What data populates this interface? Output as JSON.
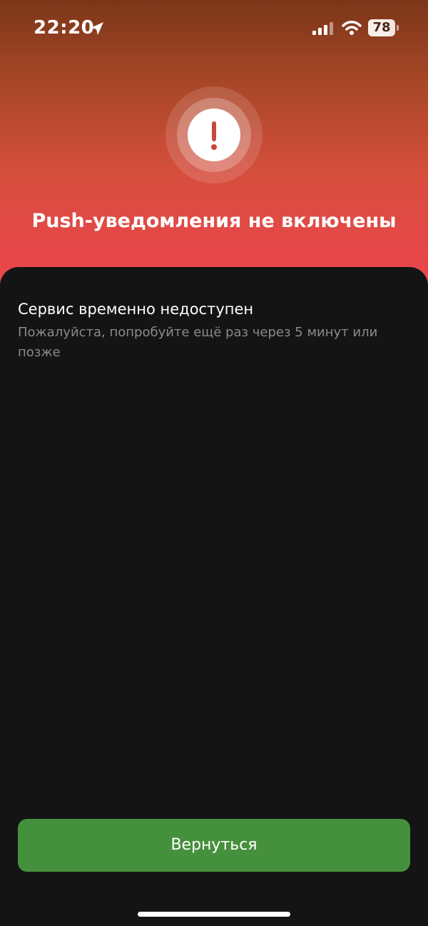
{
  "status_bar": {
    "time": "22:20",
    "battery_level": "78",
    "icons": [
      "location-arrow-icon",
      "cellular-signal-icon",
      "wifi-icon",
      "battery-icon"
    ]
  },
  "alert": {
    "icon": "exclamation-icon",
    "title": "Push-уведомления не включены"
  },
  "message": {
    "title": "Сервис временно недоступен",
    "body": "Пожалуйста, попробуйте ещё раз через 5 минут или позже"
  },
  "actions": {
    "back_label": "Вернуться"
  },
  "colors": {
    "hero_top": "#7b3618",
    "hero_bottom": "#e8474a",
    "background": "#141414",
    "primary_button": "#45903c",
    "alert_mark": "#c9473b",
    "secondary_text": "#8a8a8a"
  }
}
